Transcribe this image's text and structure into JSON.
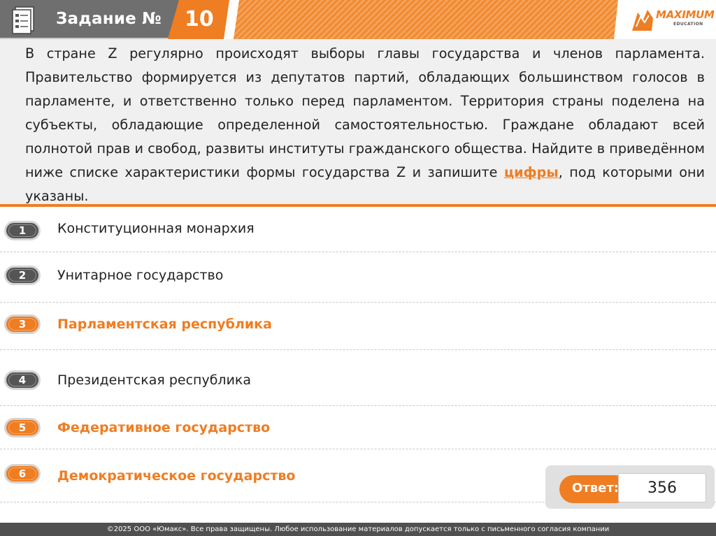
{
  "header": {
    "title": "Задание №",
    "number": "10",
    "logo_text": "MAXIMUM",
    "logo_sub": "EDUCATION"
  },
  "question": {
    "text_before": "В стране Z регулярно происходят выборы главы государства и членов парламента. Правительство формируется из депутатов партий, обладающих большинством голосов в парламенте, и ответственно только перед парламентом. Территория страны поделена на субъекты, обладающие определенной самостоятельностью. Граждане обладают всей полнотой прав и свобод, развиты институты гражданского общества. Найдите в приведённом ниже списке характеристики формы государства Z и запишите",
    "highlight": "цифры",
    "text_after": ", под которыми они указаны."
  },
  "options": [
    {
      "num": "1",
      "label": "Конституционная монархия",
      "correct": false
    },
    {
      "num": "2",
      "label": "Унитарное государство",
      "correct": false
    },
    {
      "num": "3",
      "label": "Парламентская республика",
      "correct": true
    },
    {
      "num": "4",
      "label": "Президентская республика",
      "correct": false
    },
    {
      "num": "5",
      "label": "Федеративное государство",
      "correct": true
    },
    {
      "num": "6",
      "label": "Демократическое государство",
      "correct": true
    }
  ],
  "answer": {
    "label": "Ответ:",
    "value": "356"
  },
  "footer": {
    "text": "©2025 ООО «Юмакс». Все права защищены. Любое использование материалов допускается только с  письменного согласия компании"
  },
  "colors": {
    "accent": "#ef7d22",
    "dark_gray": "#555555",
    "header_gray": "#6f6f6f"
  }
}
